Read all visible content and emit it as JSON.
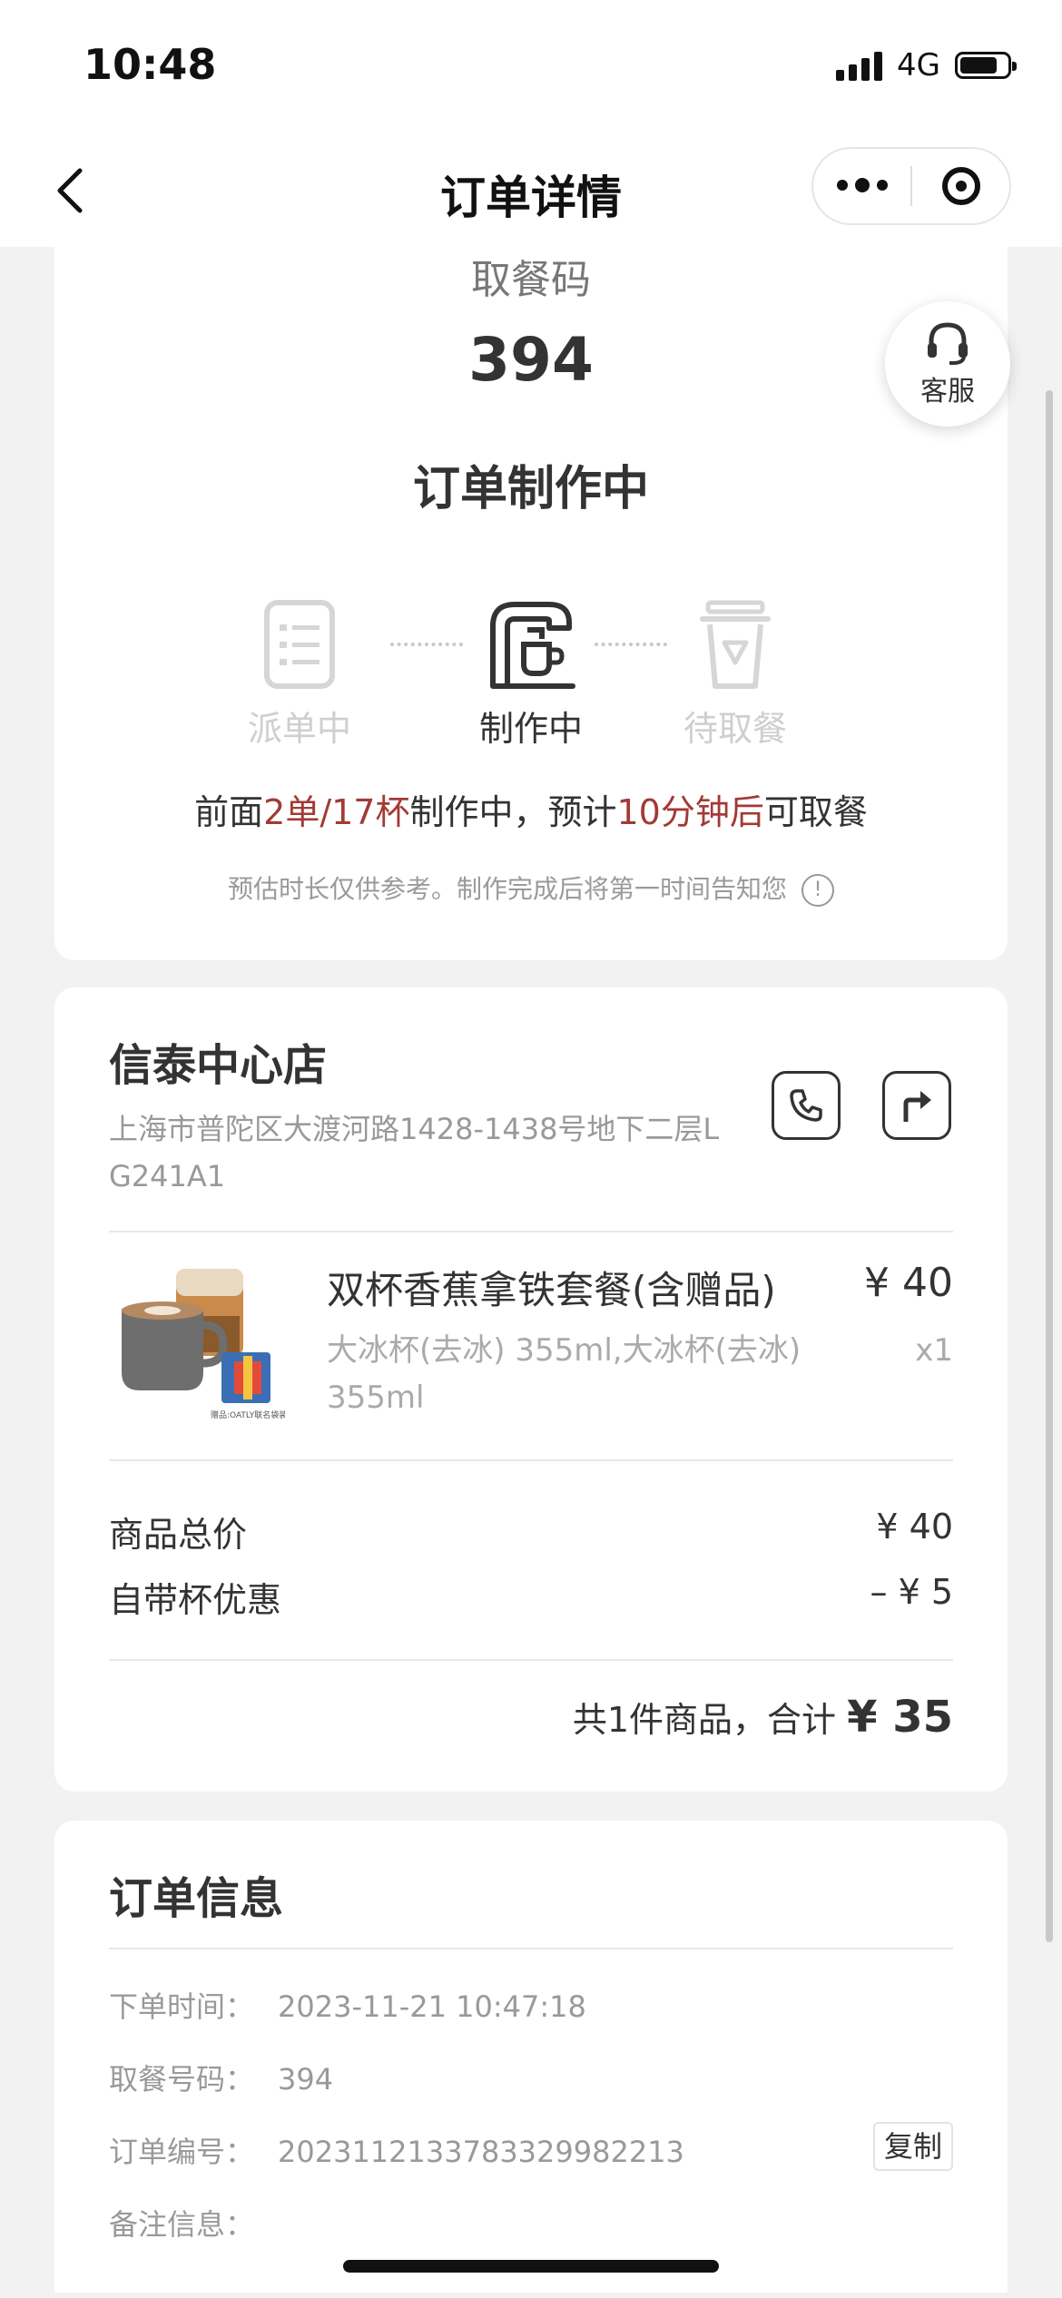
{
  "status_bar": {
    "time": "10:48",
    "network": "4G"
  },
  "nav": {
    "title": "订单详情"
  },
  "pickup": {
    "label": "取餐码",
    "code": "394",
    "status": "订单制作中",
    "steps": [
      {
        "label": "派单中",
        "active": false
      },
      {
        "label": "制作中",
        "active": true
      },
      {
        "label": "待取餐",
        "active": false
      }
    ],
    "queue": {
      "prefix": "前面",
      "count": "2单/17杯",
      "middle": "制作中，预计",
      "eta": "10分钟后",
      "suffix": "可取餐"
    },
    "hint": "预估时长仅供参考。制作完成后将第一时间告知您",
    "highlight_color": "#a33a35"
  },
  "support": {
    "label": "客服"
  },
  "store": {
    "name": "信泰中心店",
    "address": "上海市普陀区大渡河路1428-1438号地下二层L G241A1"
  },
  "product": {
    "name": "双杯香蕉拿铁套餐(含赠品)",
    "price": "¥ 40",
    "spec": "大冰杯(去冰) 355ml,大冰杯(去冰) 355ml",
    "qty": "x1",
    "image_caption": "赠品:OATLY联名袋装"
  },
  "summary": {
    "subtotal_label": "商品总价",
    "subtotal_value": "¥ 40",
    "discount_label": "自带杯优惠",
    "discount_value": "– ¥ 5",
    "total_prefix": "共1件商品，合计",
    "total_amount": "¥ 35"
  },
  "order_info": {
    "title": "订单信息",
    "rows": [
      {
        "key": "下单时间：",
        "value": "2023-11-21 10:47:18"
      },
      {
        "key": "取餐号码：",
        "value": "394"
      },
      {
        "key": "订单编号：",
        "value": "2023112133783329982213"
      },
      {
        "key": "备注信息：",
        "value": ""
      }
    ],
    "copy_label": "复制"
  }
}
